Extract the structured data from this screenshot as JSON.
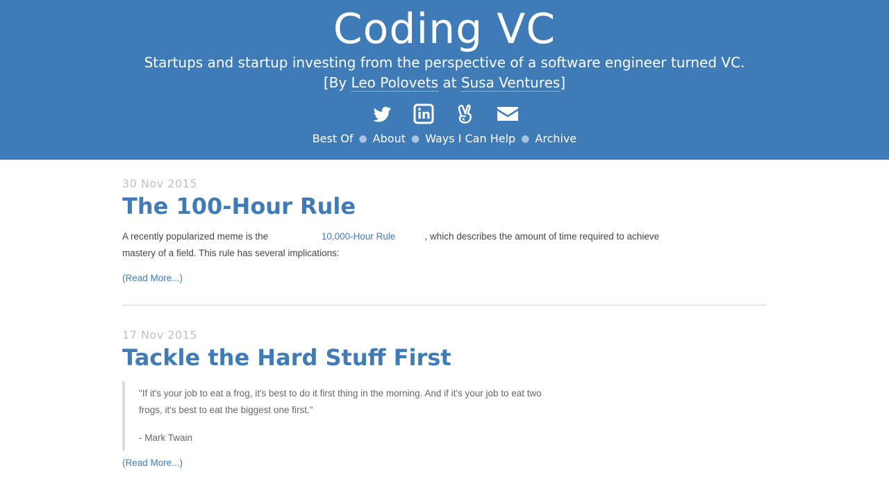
{
  "header": {
    "title": "Coding VC",
    "tagline": "Startups and startup investing from the perspective of a software engineer turned VC.",
    "byline": {
      "open": "[By ",
      "author": "Leo Polovets",
      "at": " at ",
      "company": "Susa Ventures",
      "close": "]"
    },
    "social": [
      "twitter-icon",
      "linkedin-icon",
      "angellist-icon",
      "envelope-icon"
    ],
    "nav": [
      "Best Of",
      "About",
      "Ways I Can Help",
      "Archive"
    ]
  },
  "posts": [
    {
      "date": "30 Nov 2015",
      "title": "The 100-Hour Rule",
      "body_pre": "A recently popularized meme is the ",
      "body_link": "10,000-Hour Rule",
      "body_post": ", which describes the amount of time required to achieve mastery of a field. This rule has several implications:",
      "read_more": "(Read More...)"
    },
    {
      "date": "17 Nov 2015",
      "title": "Tackle the Hard Stuff First",
      "quote": "\"If it's your job to eat a frog, it's best to do it first thing in the morning. And if it's your job to eat two frogs, it's best to eat the biggest one first.\"",
      "attribution": "- Mark Twain",
      "read_more": "(Read More...)"
    }
  ],
  "colors": {
    "header_bg": "#3f7bb6",
    "link": "#3f7bb6",
    "date": "#bfbfbf"
  }
}
